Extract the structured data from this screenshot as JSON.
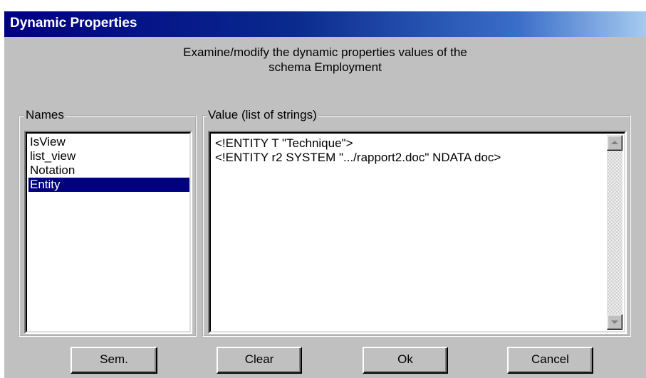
{
  "window": {
    "title": "Dynamic Properties"
  },
  "description": {
    "line1": "Examine/modify the dynamic properties values of the",
    "line2": "schema Employment"
  },
  "names_panel": {
    "label": "Names",
    "items": [
      "IsView",
      "list_view",
      "Notation",
      "Entity"
    ],
    "selected_item": "Entity"
  },
  "value_panel": {
    "label": "Value (list of strings)",
    "lines": [
      "<!ENTITY T \"Technique\">",
      "<!ENTITY r2 SYSTEM \".../rapport2.doc\" NDATA doc>"
    ]
  },
  "scrollbar": {
    "up_icon": "triangle-up-icon",
    "down_icon": "triangle-down-icon"
  },
  "buttons": {
    "sem": "Sem.",
    "clear": "Clear",
    "ok": "Ok",
    "cancel": "Cancel"
  },
  "colors": {
    "title_bar": "#000080",
    "dialog_face": "#c0c0c0",
    "selection": "#000080"
  }
}
